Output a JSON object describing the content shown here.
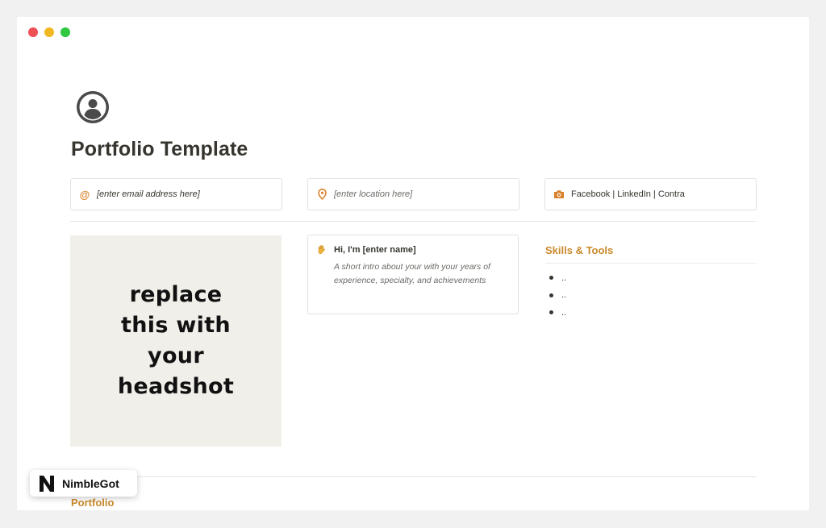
{
  "page": {
    "title": "Portfolio Template"
  },
  "info": {
    "email_placeholder": "[enter email address here]",
    "location_placeholder": "[enter location here]",
    "social_links": "Facebook | LinkedIn | Contra"
  },
  "headshot": {
    "line1": "replace",
    "line2": "this with",
    "line3": "your",
    "line4": "headshot"
  },
  "intro": {
    "greeting": "Hi, I'm [enter name]",
    "description_line1": "A short intro about your with your years of",
    "description_line2": "experience, specialty, and achievements"
  },
  "skills": {
    "title": "Skills & Tools",
    "items": [
      "..",
      "..",
      ".."
    ]
  },
  "portfolio": {
    "heading": "Portfolio"
  },
  "badge": {
    "brand": "NimbleGot"
  },
  "colors": {
    "accent": "#c98a2d",
    "icon_orange": "#d9822b"
  }
}
